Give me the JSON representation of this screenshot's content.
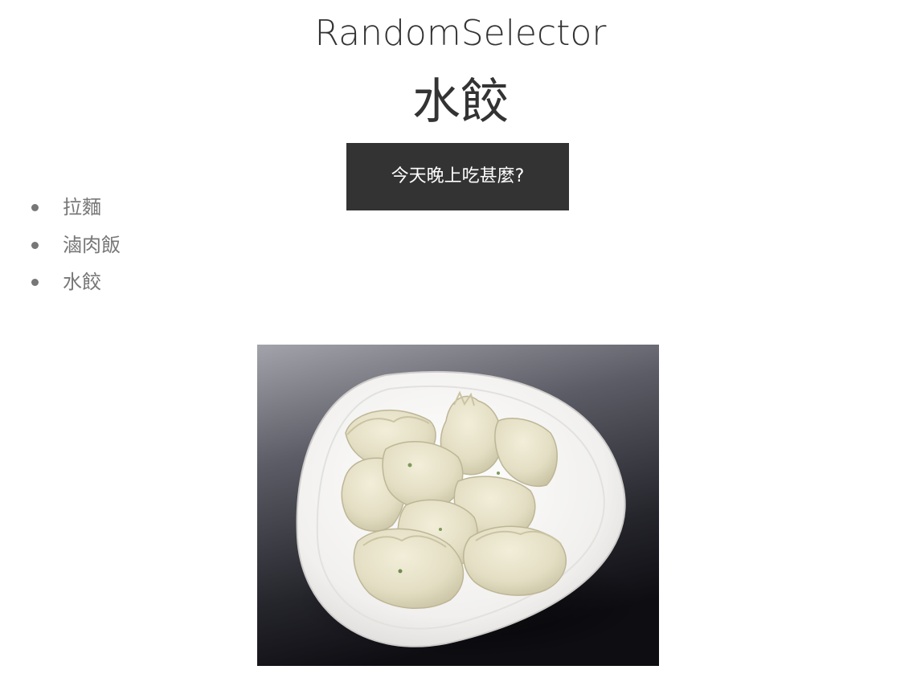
{
  "header": {
    "app_title": "RandomSelector"
  },
  "result": {
    "selected": "水餃"
  },
  "controls": {
    "pick_label": "今天晚上吃甚麼?"
  },
  "options": [
    {
      "label": "拉麵"
    },
    {
      "label": "滷肉飯"
    },
    {
      "label": "水餃"
    }
  ],
  "photo": {
    "subject": "dumplings-on-white-plate",
    "colors": {
      "background_top": "#9a9aa2",
      "background_bottom": "#15151b",
      "plate": "#f4f3f1",
      "dumpling": "#e6e1c8",
      "dumpling_shadow": "#c9c3a3"
    }
  },
  "theme": {
    "button_bg": "#333333",
    "button_text": "#ffffff",
    "text_dark": "#333333",
    "text_muted": "#777777"
  }
}
